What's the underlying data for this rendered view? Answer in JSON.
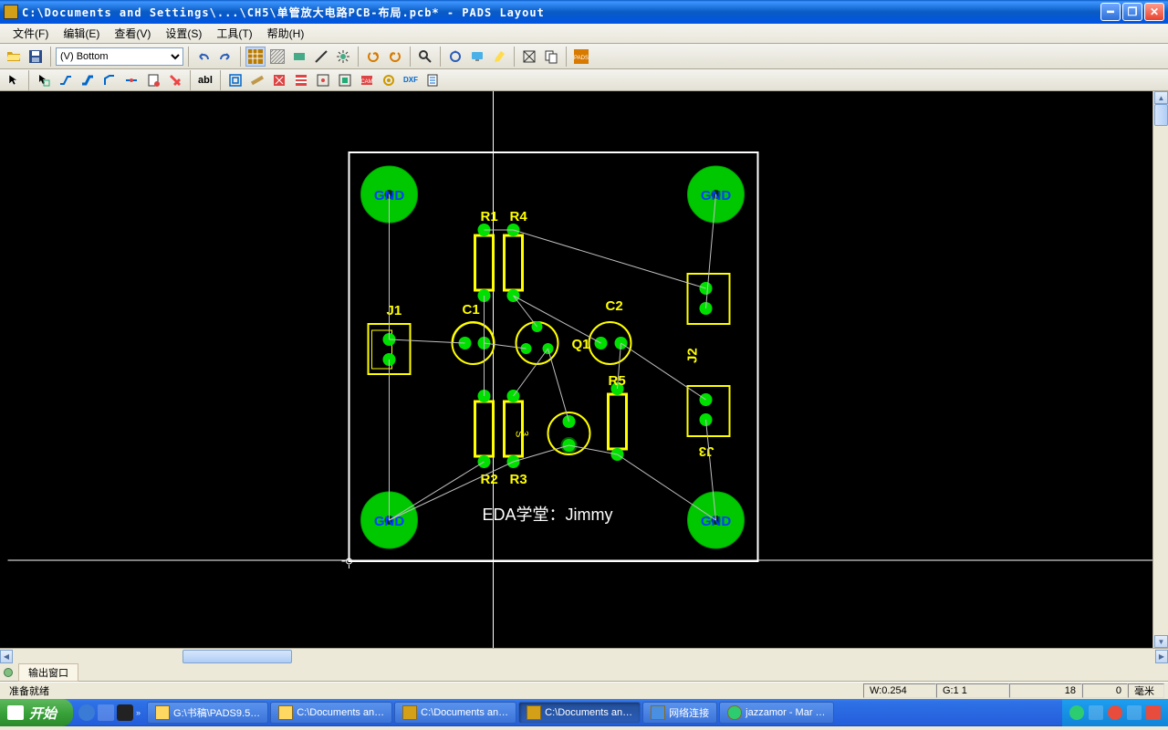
{
  "title": "C:\\Documents and Settings\\...\\CH5\\单管放大电路PCB-布局.pcb* - PADS Layout",
  "menu": {
    "file": "文件(F)",
    "edit": "编辑(E)",
    "view": "查看(V)",
    "setup": "设置(S)",
    "tools": "工具(T)",
    "help": "帮助(H)"
  },
  "layer_selected": "(V) Bottom",
  "output_tab": "输出窗口",
  "status": {
    "ready": "准备就绪",
    "w": "W:0.254",
    "g": "G:1 1",
    "x": "18",
    "y": "0",
    "unit": "毫米"
  },
  "design": {
    "gnd_label": "GND",
    "j1": "J1",
    "j2": "J2",
    "j3": "J3",
    "c1": "C1",
    "c2": "C2",
    "q1": "Q1",
    "r1": "R1",
    "r2": "R2",
    "r3": "R3",
    "r4": "R4",
    "r5": "R5",
    "signature": "EDA学堂：Jimmy"
  },
  "taskbar": {
    "start": "开始",
    "task1": "G:\\书稿\\PADS9.5…",
    "task2": "C:\\Documents an…",
    "task3": "C:\\Documents an…",
    "task4": "C:\\Documents an…",
    "task5": "网络连接",
    "task6": "jazzamor - Mar …"
  }
}
